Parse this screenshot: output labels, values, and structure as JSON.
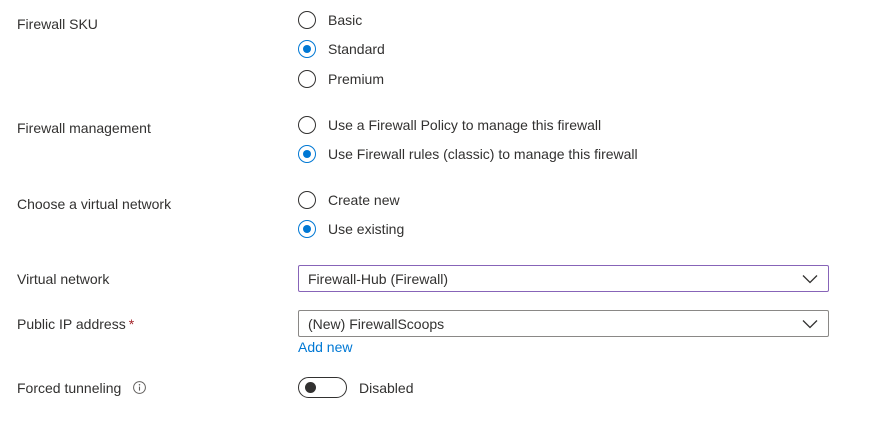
{
  "fields": {
    "firewall_sku": {
      "label": "Firewall SKU",
      "options": [
        "Basic",
        "Standard",
        "Premium"
      ],
      "selected": "Standard"
    },
    "firewall_management": {
      "label": "Firewall management",
      "options": [
        "Use a Firewall Policy to manage this firewall",
        "Use Firewall rules (classic) to manage this firewall"
      ],
      "selected": "Use Firewall rules (classic) to manage this firewall"
    },
    "virtual_network_choice": {
      "label": "Choose a virtual network",
      "options": [
        "Create new",
        "Use existing"
      ],
      "selected": "Use existing"
    },
    "virtual_network": {
      "label": "Virtual network",
      "value": "Firewall-Hub (Firewall)"
    },
    "public_ip": {
      "label": "Public IP address",
      "required_marker": "*",
      "value": "(New) FirewallScoops",
      "add_new_link": "Add new"
    },
    "forced_tunneling": {
      "label": "Forced tunneling",
      "info_icon": "info-icon",
      "state": "Disabled",
      "enabled": false
    }
  },
  "colors": {
    "accent": "#0078d4",
    "text": "#323130",
    "required": "#a4262c",
    "focus_border": "#8764b8",
    "border": "#8a8886"
  }
}
